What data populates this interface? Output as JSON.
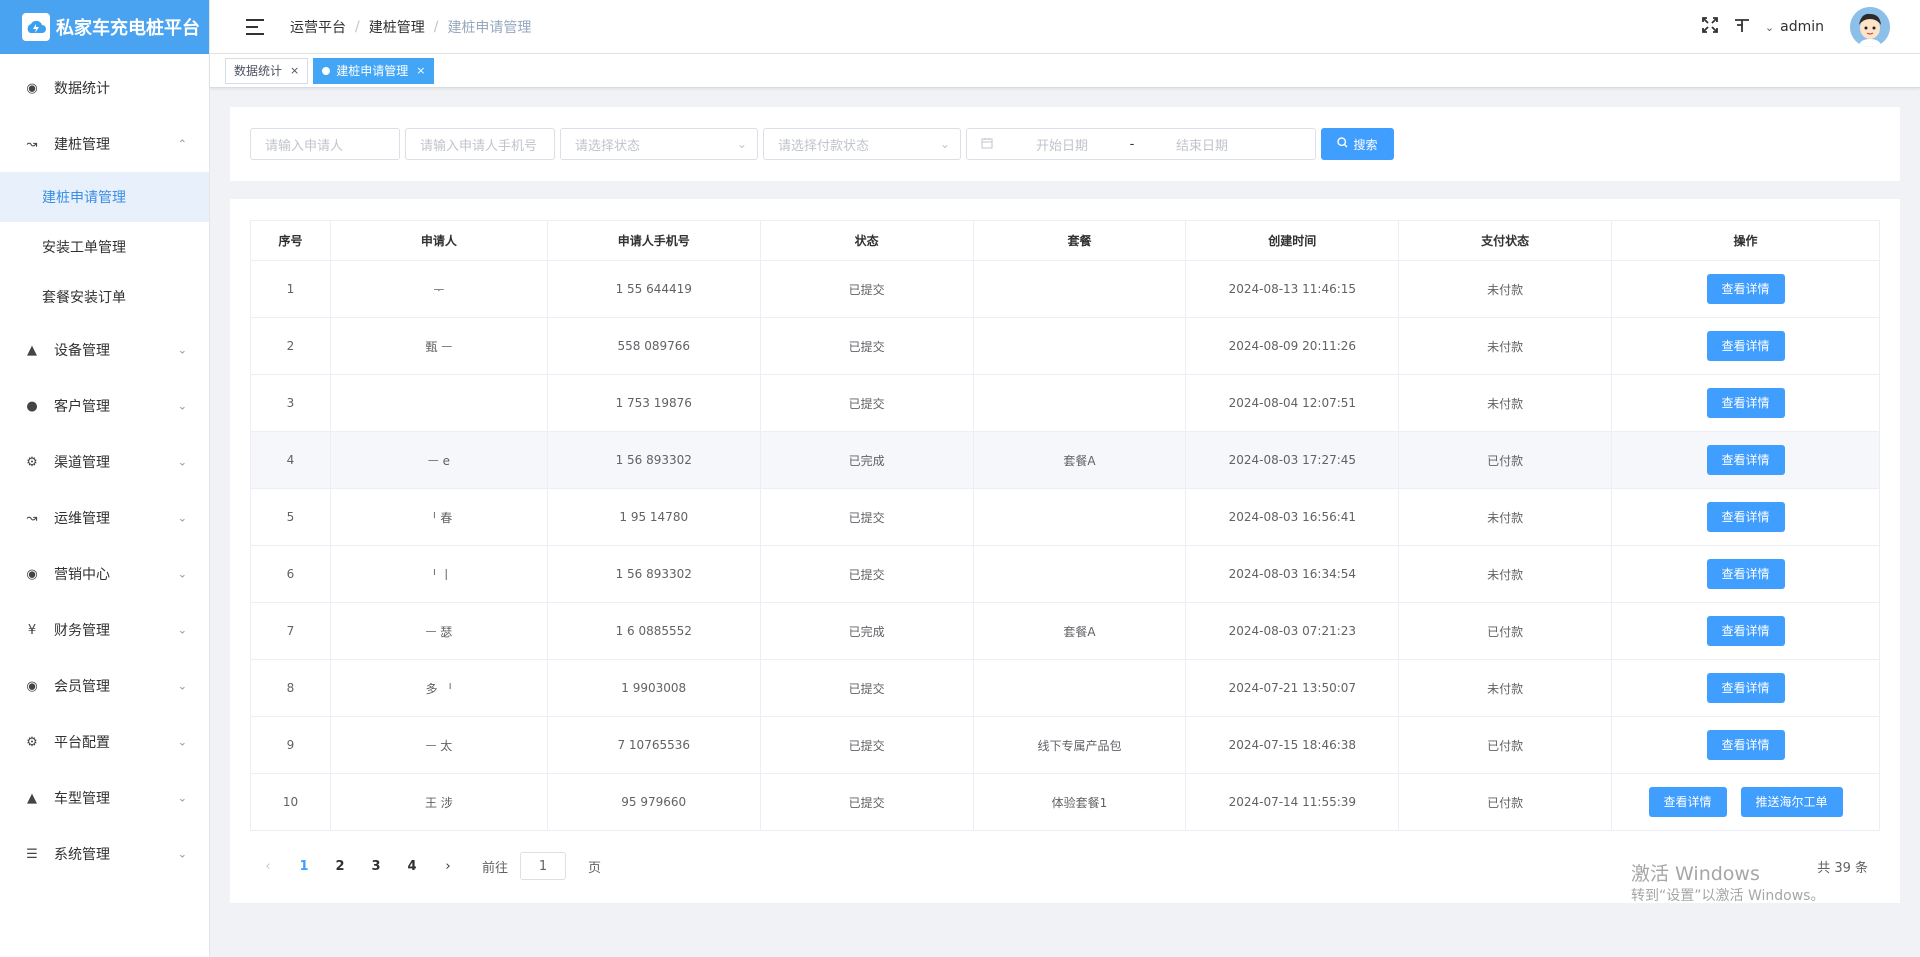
{
  "app": {
    "title": "私家车充电桩平台"
  },
  "sidebar": {
    "items": [
      {
        "label": "数据统计",
        "icon": "dashboard-icon"
      },
      {
        "label": "建桩管理",
        "icon": "chart-icon",
        "expanded": true,
        "children": [
          {
            "label": "建桩申请管理",
            "active": true
          },
          {
            "label": "安装工单管理"
          },
          {
            "label": "套餐安装订单"
          }
        ]
      },
      {
        "label": "设备管理",
        "icon": "device-icon"
      },
      {
        "label": "客户管理",
        "icon": "user-icon"
      },
      {
        "label": "渠道管理",
        "icon": "gear-icon"
      },
      {
        "label": "运维管理",
        "icon": "chart-icon"
      },
      {
        "label": "营销中心",
        "icon": "marketing-icon"
      },
      {
        "label": "财务管理",
        "icon": "yen-icon"
      },
      {
        "label": "会员管理",
        "icon": "member-icon"
      },
      {
        "label": "平台配置",
        "icon": "gear-icon"
      },
      {
        "label": "车型管理",
        "icon": "device-icon"
      },
      {
        "label": "系统管理",
        "icon": "list-icon"
      }
    ]
  },
  "header": {
    "breadcrumb": [
      "运营平台",
      "建桩管理",
      "建桩申请管理"
    ],
    "user": "admin"
  },
  "tags": [
    {
      "label": "数据统计",
      "active": false
    },
    {
      "label": "建桩申请管理",
      "active": true
    }
  ],
  "search": {
    "applicant_placeholder": "请输入申请人",
    "phone_placeholder": "请输入申请人手机号",
    "status_placeholder": "请选择状态",
    "pay_status_placeholder": "请选择付款状态",
    "start_date_placeholder": "开始日期",
    "date_separator": "-",
    "end_date_placeholder": "结束日期",
    "search_label": "搜索"
  },
  "table": {
    "columns": [
      "序号",
      "申请人",
      "申请人手机号",
      "状态",
      "套餐",
      "创建时间",
      "支付状态",
      "操作"
    ],
    "rows": [
      {
        "no": "1",
        "applicant": "ᅮ",
        "phone": "1 55 644419",
        "status": "已提交",
        "package": "",
        "created": "2024-08-13 11:46:15",
        "pay": "未付款"
      },
      {
        "no": "2",
        "applicant": "甄 ᅳ",
        "phone": "558 089766",
        "status": "已提交",
        "package": "",
        "created": "2024-08-09 20:11:26",
        "pay": "未付款"
      },
      {
        "no": "3",
        "applicant": "",
        "phone": "1 753 19876",
        "status": "已提交",
        "package": "",
        "created": "2024-08-04 12:07:51",
        "pay": "未付款"
      },
      {
        "no": "4",
        "applicant": "ᅳ e",
        "phone": "1 56 893302",
        "status": "已完成",
        "package": "套餐A",
        "created": "2024-08-03 17:27:45",
        "pay": "已付款"
      },
      {
        "no": "5",
        "applicant": "ᅵ 春",
        "phone": "1 95 14780",
        "status": "已提交",
        "package": "",
        "created": "2024-08-03 16:56:41",
        "pay": "未付款"
      },
      {
        "no": "6",
        "applicant": "ᅵ 丨",
        "phone": "1 56 893302",
        "status": "已提交",
        "package": "",
        "created": "2024-08-03 16:34:54",
        "pay": "未付款"
      },
      {
        "no": "7",
        "applicant": "ᅳ 瑟",
        "phone": "1 6 0885552",
        "status": "已完成",
        "package": "套餐A",
        "created": "2024-08-03 07:21:23",
        "pay": "已付款"
      },
      {
        "no": "8",
        "applicant": "多 ᅵ",
        "phone": "1 9903008",
        "status": "已提交",
        "package": "",
        "created": "2024-07-21 13:50:07",
        "pay": "未付款"
      },
      {
        "no": "9",
        "applicant": "ᅳ 太",
        "phone": "7 10765536",
        "status": "已提交",
        "package": "线下专属产品包",
        "created": "2024-07-15 18:46:38",
        "pay": "已付款"
      },
      {
        "no": "10",
        "applicant": "王 涉",
        "phone": "95 979660",
        "status": "已提交",
        "package": "体验套餐1",
        "created": "2024-07-14 11:55:39",
        "pay": "已付款",
        "extra_action": "推送海尔工单"
      }
    ],
    "detail_label": "查看详情"
  },
  "pagination": {
    "pages": [
      "1",
      "2",
      "3",
      "4"
    ],
    "current": "1",
    "goto_label": "前往",
    "goto_value": "1",
    "goto_unit": "页",
    "total": "共 39 条"
  },
  "watermark": {
    "line1": "激活 Windows",
    "line2": "转到“设置”以激活 Windows。"
  },
  "colors": {
    "primary": "#409eff",
    "logo_bg": "#4aa3f0",
    "active_tag": "#42a5f5"
  }
}
